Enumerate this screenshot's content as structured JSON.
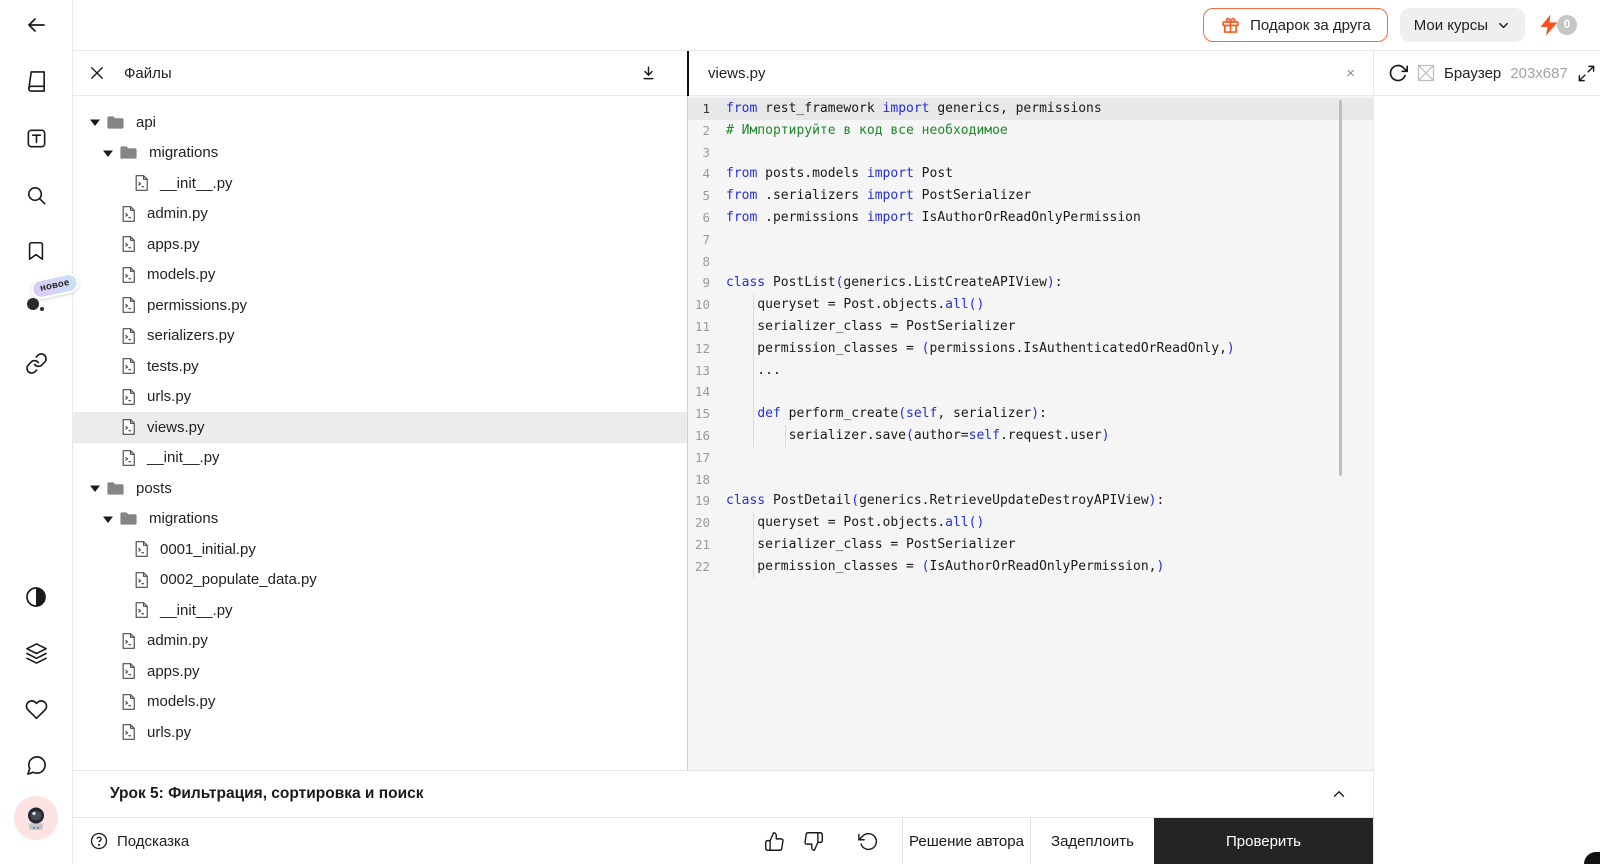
{
  "topbar": {
    "gift_label": "Подарок за друга",
    "courses_label": "Мои курсы",
    "energy_count": "0"
  },
  "sidebar": {
    "new_badge": "новое",
    "icons": [
      "back-icon",
      "book-icon",
      "text-tool-icon",
      "search-icon",
      "bookmark-icon",
      "ai-new-icon",
      "link-icon",
      "contrast-icon",
      "layers-icon",
      "heart-icon",
      "chat-icon",
      "avatar"
    ]
  },
  "files_panel": {
    "title": "Файлы",
    "icons": [
      "close-icon",
      "download-icon"
    ],
    "tree": [
      {
        "label": "api",
        "type": "folder",
        "level": 0
      },
      {
        "label": "migrations",
        "type": "folder",
        "level": 1
      },
      {
        "label": "__init__.py",
        "type": "file",
        "level": 2
      },
      {
        "label": "admin.py",
        "type": "file",
        "level": 1
      },
      {
        "label": "apps.py",
        "type": "file",
        "level": 1
      },
      {
        "label": "models.py",
        "type": "file",
        "level": 1
      },
      {
        "label": "permissions.py",
        "type": "file",
        "level": 1
      },
      {
        "label": "serializers.py",
        "type": "file",
        "level": 1
      },
      {
        "label": "tests.py",
        "type": "file",
        "level": 1
      },
      {
        "label": "urls.py",
        "type": "file",
        "level": 1
      },
      {
        "label": "views.py",
        "type": "file",
        "level": 1,
        "selected": true
      },
      {
        "label": "__init__.py",
        "type": "file",
        "level": 1
      },
      {
        "label": "posts",
        "type": "folder",
        "level": 0
      },
      {
        "label": "migrations",
        "type": "folder",
        "level": 1
      },
      {
        "label": "0001_initial.py",
        "type": "file",
        "level": 2
      },
      {
        "label": "0002_populate_data.py",
        "type": "file",
        "level": 2
      },
      {
        "label": "__init__.py",
        "type": "file",
        "level": 2
      },
      {
        "label": "admin.py",
        "type": "file",
        "level": 1
      },
      {
        "label": "apps.py",
        "type": "file",
        "level": 1
      },
      {
        "label": "models.py",
        "type": "file",
        "level": 1
      },
      {
        "label": "urls.py",
        "type": "file",
        "level": 1
      }
    ]
  },
  "editor": {
    "tab": "views.py",
    "close_label": "×",
    "lines": [
      {
        "n": 1,
        "active": true,
        "t": [
          [
            "k",
            "from"
          ],
          [
            "p",
            " rest_framework "
          ],
          [
            "k",
            "import"
          ],
          [
            "p",
            " generics, permissions"
          ]
        ]
      },
      {
        "n": 2,
        "t": [
          [
            "c",
            "# Импортируйте в код все необходимое"
          ]
        ]
      },
      {
        "n": 3,
        "t": []
      },
      {
        "n": 4,
        "t": [
          [
            "k",
            "from"
          ],
          [
            "p",
            " posts.models "
          ],
          [
            "k",
            "import"
          ],
          [
            "p",
            " Post"
          ]
        ]
      },
      {
        "n": 5,
        "t": [
          [
            "k",
            "from"
          ],
          [
            "p",
            " .serializers "
          ],
          [
            "k",
            "import"
          ],
          [
            "p",
            " PostSerializer"
          ]
        ]
      },
      {
        "n": 6,
        "t": [
          [
            "k",
            "from"
          ],
          [
            "p",
            " .permissions "
          ],
          [
            "k",
            "import"
          ],
          [
            "p",
            " IsAuthorOrReadOnlyPermission"
          ]
        ]
      },
      {
        "n": 7,
        "t": []
      },
      {
        "n": 8,
        "t": []
      },
      {
        "n": 9,
        "t": [
          [
            "k",
            "class"
          ],
          [
            "p",
            " PostList"
          ],
          [
            "b",
            "("
          ],
          [
            "p",
            "generics.ListCreateAPIView"
          ],
          [
            "b",
            ")"
          ],
          [
            "p",
            ":"
          ]
        ]
      },
      {
        "n": 10,
        "g": 1,
        "t": [
          [
            "p",
            "    queryset = Post.objects."
          ],
          [
            "b",
            "all()"
          ]
        ]
      },
      {
        "n": 11,
        "g": 1,
        "t": [
          [
            "p",
            "    serializer_class = PostSerializer"
          ]
        ]
      },
      {
        "n": 12,
        "g": 1,
        "t": [
          [
            "p",
            "    permission_classes = "
          ],
          [
            "b",
            "("
          ],
          [
            "p",
            "permissions.IsAuthenticatedOrReadOnly,"
          ],
          [
            "b",
            ")"
          ]
        ]
      },
      {
        "n": 13,
        "g": 1,
        "t": [
          [
            "p",
            "    ..."
          ]
        ]
      },
      {
        "n": 14,
        "g": 1,
        "t": []
      },
      {
        "n": 15,
        "g": 1,
        "t": [
          [
            "p",
            "    "
          ],
          [
            "k",
            "def"
          ],
          [
            "p",
            " perform_create"
          ],
          [
            "b",
            "("
          ],
          [
            "k",
            "self"
          ],
          [
            "p",
            ", serializer"
          ],
          [
            "b",
            ")"
          ],
          [
            "p",
            ":"
          ]
        ]
      },
      {
        "n": 16,
        "g": 2,
        "t": [
          [
            "p",
            "        serializer.save"
          ],
          [
            "b",
            "("
          ],
          [
            "p",
            "author="
          ],
          [
            "k",
            "self"
          ],
          [
            "p",
            ".request.user"
          ],
          [
            "b",
            ")"
          ]
        ]
      },
      {
        "n": 17,
        "t": []
      },
      {
        "n": 18,
        "t": []
      },
      {
        "n": 19,
        "t": [
          [
            "k",
            "class"
          ],
          [
            "p",
            " PostDetail"
          ],
          [
            "b",
            "("
          ],
          [
            "p",
            "generics.RetrieveUpdateDestroyAPIView"
          ],
          [
            "b",
            ")"
          ],
          [
            "p",
            ":"
          ]
        ]
      },
      {
        "n": 20,
        "g": 1,
        "t": [
          [
            "p",
            "    queryset = Post.objects."
          ],
          [
            "b",
            "all()"
          ]
        ]
      },
      {
        "n": 21,
        "g": 1,
        "t": [
          [
            "p",
            "    serializer_class = PostSerializer"
          ]
        ]
      },
      {
        "n": 22,
        "g": 1,
        "t": [
          [
            "p",
            "    permission_classes = "
          ],
          [
            "b",
            "("
          ],
          [
            "p",
            "IsAuthorOrReadOnlyPermission,"
          ],
          [
            "b",
            ")"
          ]
        ]
      }
    ]
  },
  "browser_panel": {
    "title": "Браузер",
    "size": "203x687",
    "icons": [
      "refresh-icon",
      "image-placeholder-icon",
      "expand-icon"
    ]
  },
  "lesson_bar": {
    "title": "Урок 5: Фильтрация, сортировка и поиск"
  },
  "footer": {
    "hint_label": "Подсказка",
    "author_solution_label": "Решение автора",
    "deploy_label": "Задеплоить",
    "check_label": "Проверить",
    "icons": [
      "question-icon",
      "thumbs-up-icon",
      "thumbs-down-icon",
      "reset-icon"
    ]
  },
  "colors": {
    "accent_orange": "#fc5b24",
    "keyword_blue": "#2330db",
    "comment_green": "#1b8a2a",
    "code_bg": "#f5f5f5",
    "active_line_bg": "#e8e8e8",
    "selected_row_bg": "#ececec",
    "check_button_bg": "#242424"
  }
}
